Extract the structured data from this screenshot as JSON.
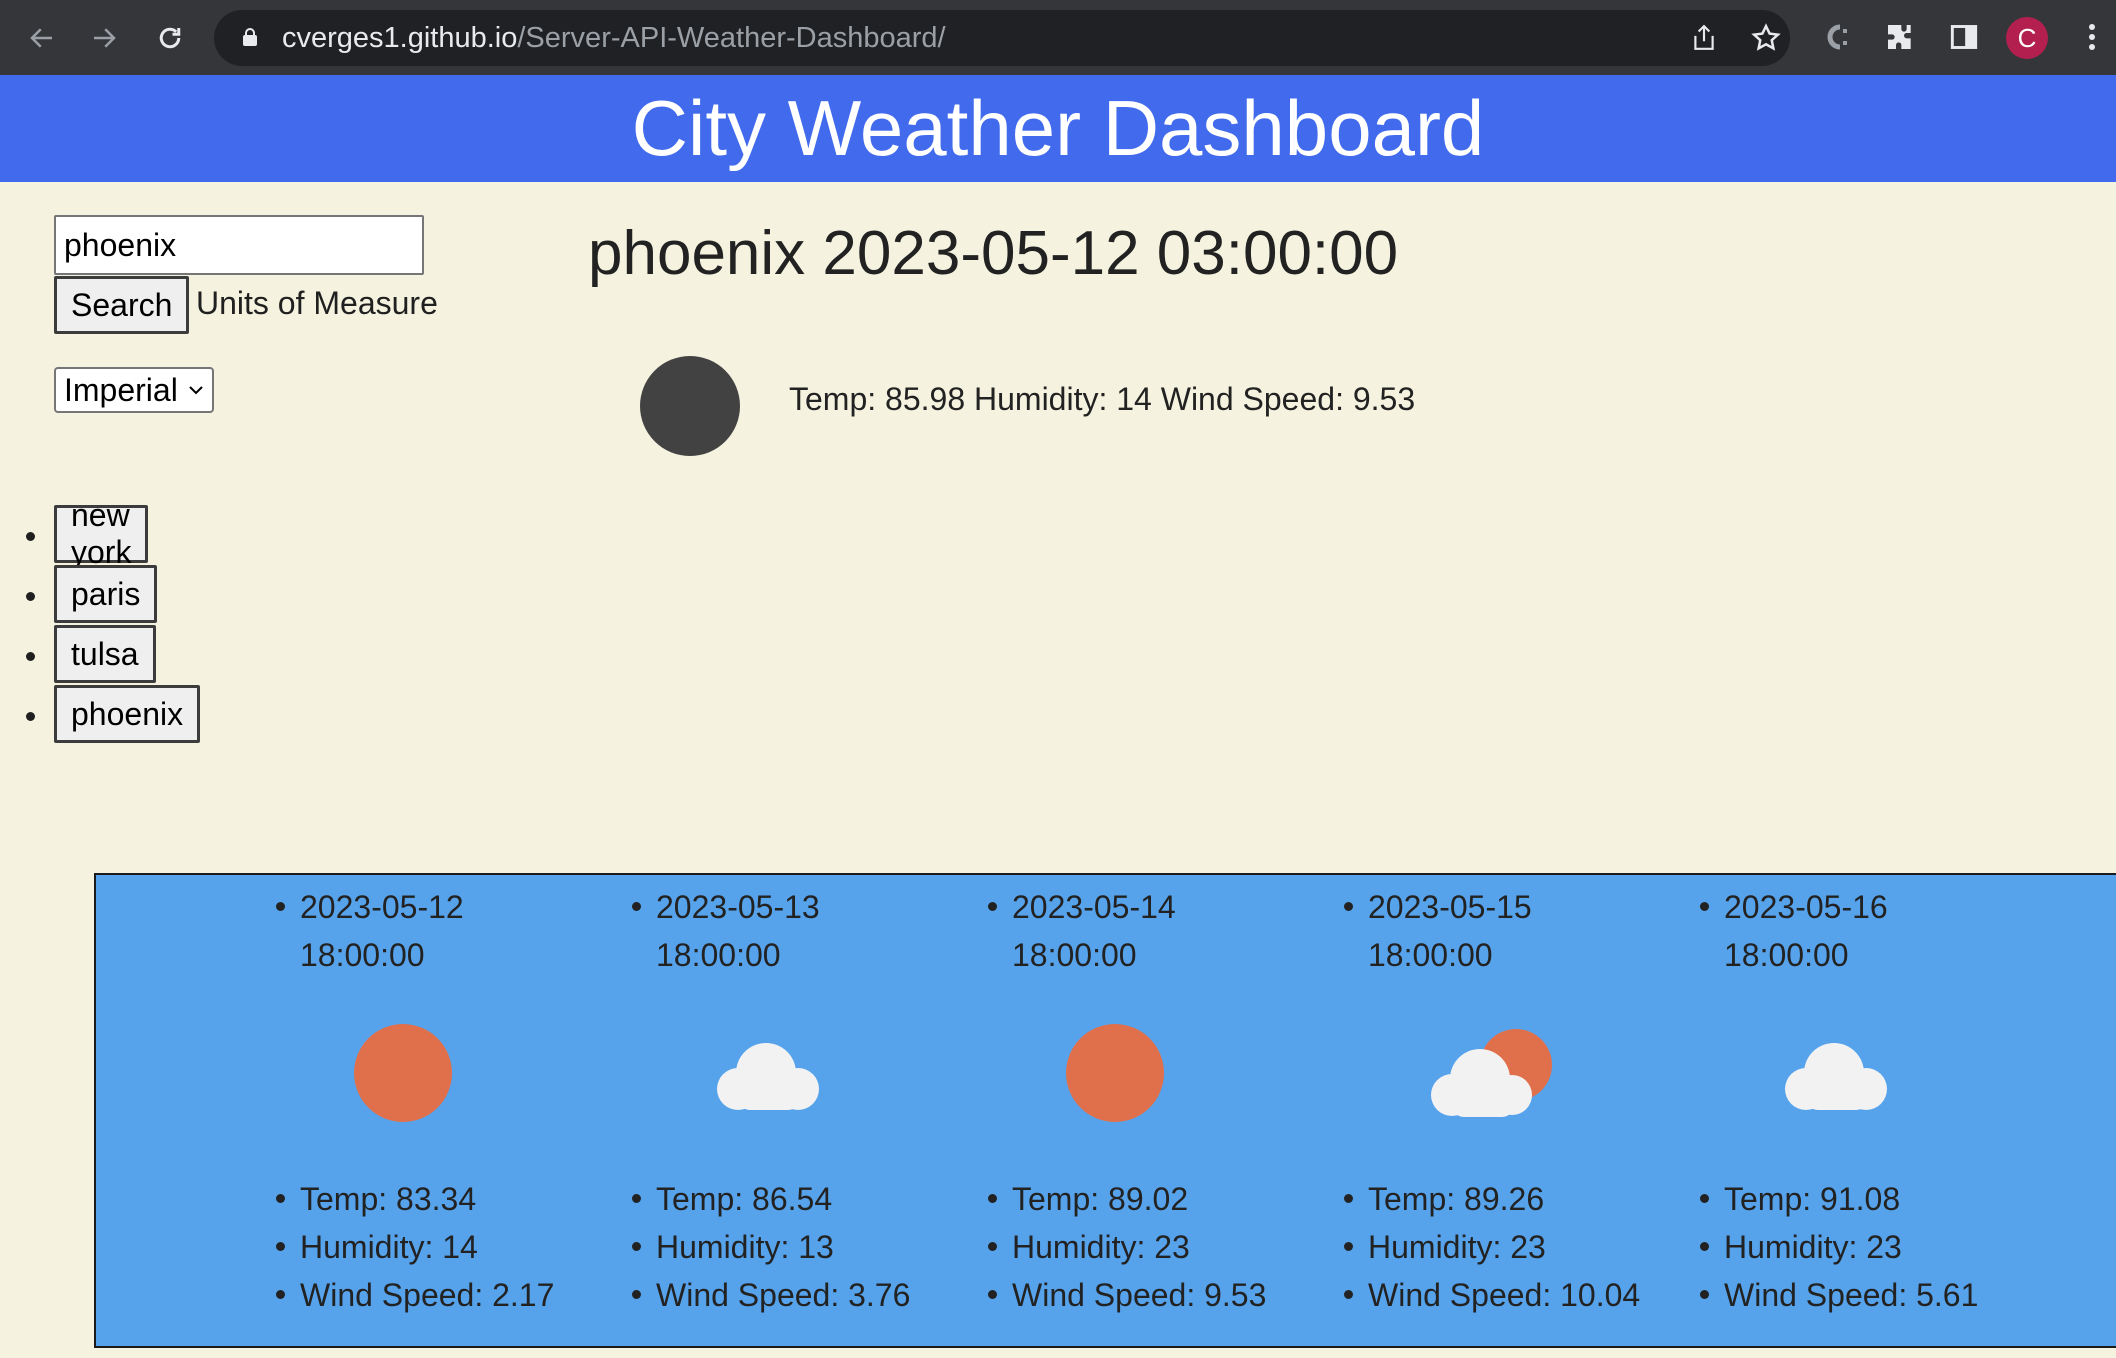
{
  "browser": {
    "url_host": "cverges1.github.io",
    "url_path": "/Server-API-Weather-Dashboard/",
    "avatar_letter": "C"
  },
  "header": {
    "title": "City Weather Dashboard"
  },
  "search": {
    "value": "phoenix",
    "button_label": "Search",
    "units_label": "Units of Measure",
    "units_selected": "Imperial"
  },
  "history": [
    {
      "label": "new york"
    },
    {
      "label": "paris"
    },
    {
      "label": "tulsa"
    },
    {
      "label": "phoenix"
    }
  ],
  "current": {
    "title": "phoenix 2023-05-12 03:00:00",
    "stats": "Temp: 85.98 Humidity: 14 Wind Speed: 9.53",
    "icon": "night-clear-icon"
  },
  "forecast": [
    {
      "date": "2023-05-12 18:00:00",
      "icon": "sun-icon",
      "temp": "Temp: 83.34",
      "humidity": "Humidity: 14",
      "wind": "Wind Speed: 2.17"
    },
    {
      "date": "2023-05-13 18:00:00",
      "icon": "cloud-icon",
      "temp": "Temp: 86.54",
      "humidity": "Humidity: 13",
      "wind": "Wind Speed: 3.76"
    },
    {
      "date": "2023-05-14 18:00:00",
      "icon": "sun-icon",
      "temp": "Temp: 89.02",
      "humidity": "Humidity: 23",
      "wind": "Wind Speed: 9.53"
    },
    {
      "date": "2023-05-15 18:00:00",
      "icon": "partly-cloudy-icon",
      "temp": "Temp: 89.26",
      "humidity": "Humidity: 23",
      "wind": "Wind Speed: 10.04"
    },
    {
      "date": "2023-05-16 18:00:00",
      "icon": "cloud-icon",
      "temp": "Temp: 91.08",
      "humidity": "Humidity: 23",
      "wind": "Wind Speed: 5.61"
    }
  ],
  "colors": {
    "header_bg": "#416bec",
    "page_bg": "#f5f3df",
    "forecast_bg": "#56a3ec",
    "sun": "#e0704c",
    "cloud": "#f2f2f2"
  }
}
